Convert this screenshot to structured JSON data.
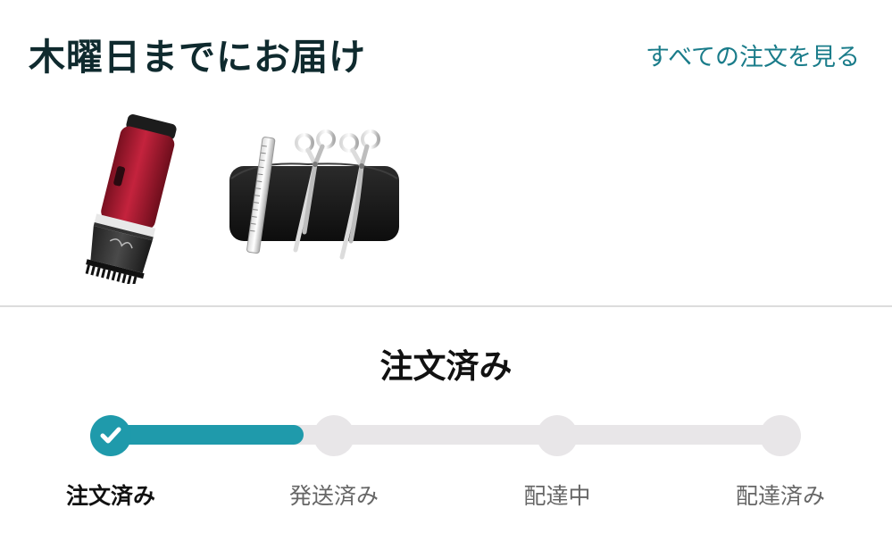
{
  "header": {
    "delivery_title": "木曜日までにお届け",
    "view_all_orders_label": "すべての注文を見る"
  },
  "products": [
    {
      "name": "hair-clipper",
      "icon": "hair-clipper-image"
    },
    {
      "name": "grooming-scissors-set",
      "icon": "scissors-set-image"
    }
  ],
  "status": {
    "heading": "注文済み",
    "progress_fraction": 0.29,
    "current_step": 0,
    "steps": [
      {
        "label": "注文済み",
        "done": true
      },
      {
        "label": "発送済み",
        "done": false
      },
      {
        "label": "配達中",
        "done": false
      },
      {
        "label": "配達済み",
        "done": false
      }
    ]
  },
  "colors": {
    "accent": "#1f9aab",
    "link": "#1a7c8a",
    "track": "#e8e6e8",
    "title": "#0f2a2e"
  }
}
